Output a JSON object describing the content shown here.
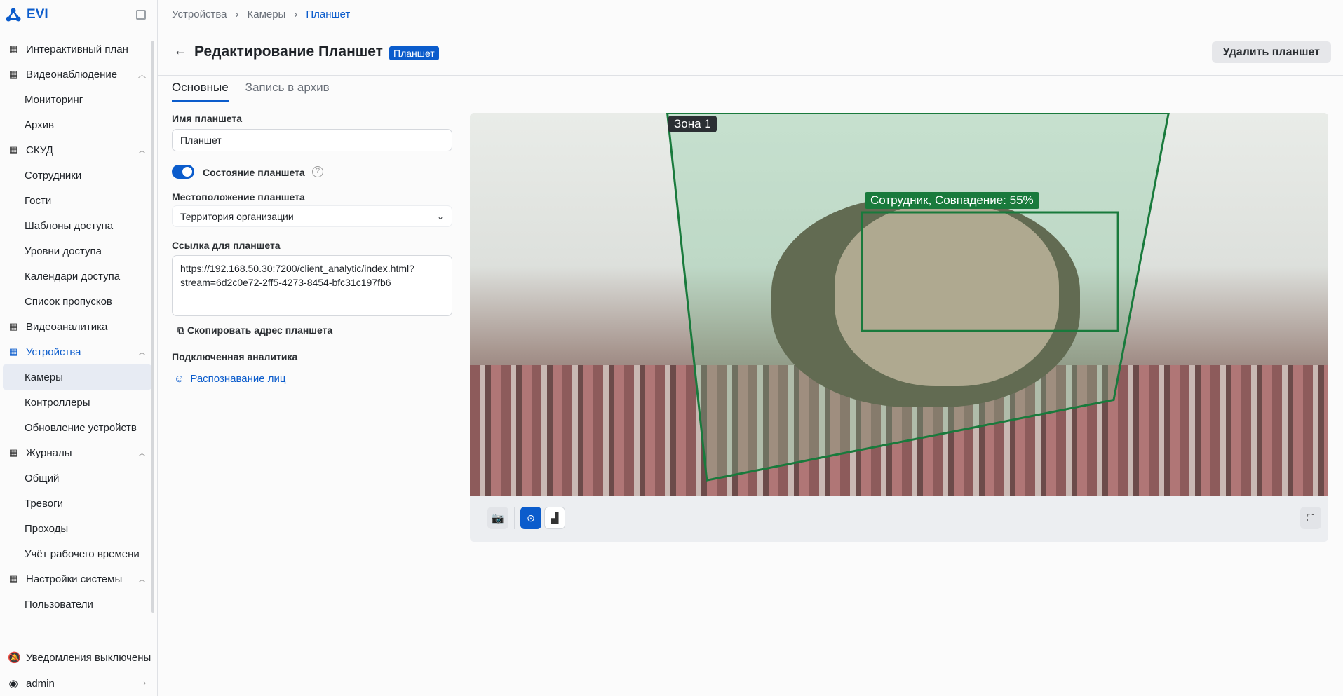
{
  "app": {
    "name": "EVI"
  },
  "sidebar": {
    "items": [
      {
        "label": "Интерактивный план",
        "icon": "map-icon"
      },
      {
        "label": "Видеонаблюдение",
        "icon": "video-grid-icon",
        "expanded": true
      },
      {
        "label": "Мониторинг",
        "sub": true
      },
      {
        "label": "Архив",
        "sub": true
      },
      {
        "label": "СКУД",
        "icon": "users-icon",
        "expanded": true
      },
      {
        "label": "Сотрудники",
        "sub": true
      },
      {
        "label": "Гости",
        "sub": true
      },
      {
        "label": "Шаблоны доступа",
        "sub": true
      },
      {
        "label": "Уровни доступа",
        "sub": true
      },
      {
        "label": "Календари доступа",
        "sub": true
      },
      {
        "label": "Список пропусков",
        "sub": true
      },
      {
        "label": "Видеоаналитика",
        "icon": "analytics-icon"
      },
      {
        "label": "Устройства",
        "icon": "devices-icon",
        "expanded": true
      },
      {
        "label": "Камеры",
        "sub": true,
        "active": true
      },
      {
        "label": "Контроллеры",
        "sub": true
      },
      {
        "label": "Обновление устройств",
        "sub": true
      },
      {
        "label": "Журналы",
        "icon": "journal-icon",
        "expanded": true
      },
      {
        "label": "Общий",
        "sub": true
      },
      {
        "label": "Тревоги",
        "sub": true
      },
      {
        "label": "Проходы",
        "sub": true
      },
      {
        "label": "Учёт рабочего времени",
        "sub": true
      },
      {
        "label": "Настройки системы",
        "icon": "gear-icon",
        "expanded": true
      },
      {
        "label": "Пользователи",
        "sub": true
      }
    ],
    "notifications": "Уведомления выключены",
    "user": "admin"
  },
  "breadcrumb": [
    "Устройства",
    "Камеры",
    "Планшет"
  ],
  "header": {
    "title": "Редактирование Планшет",
    "badge": "Планшет",
    "delete": "Удалить планшет"
  },
  "tabs": [
    "Основные",
    "Запись в архив"
  ],
  "form": {
    "name_label": "Имя планшета",
    "name_value": "Планшет",
    "state_label": "Состояние планшета",
    "state_on": true,
    "location_label": "Местоположение планшета",
    "location_value": "Территория организации",
    "link_label": "Ссылка для планшета",
    "link_value": "https://192.168.50.30:7200/client_analytic/index.html?\nstream=6d2c0e72-2ff5-4273-8454-bfc31c197fb6",
    "copy": "Скопировать адрес планшета",
    "analytics_label": "Подключенная аналитика",
    "analytics_item": "Распознавание лиц"
  },
  "video": {
    "zone": "Зона 1",
    "detection": "Сотрудник, Совпадение: 55%",
    "zone_color": "#197a3c"
  }
}
